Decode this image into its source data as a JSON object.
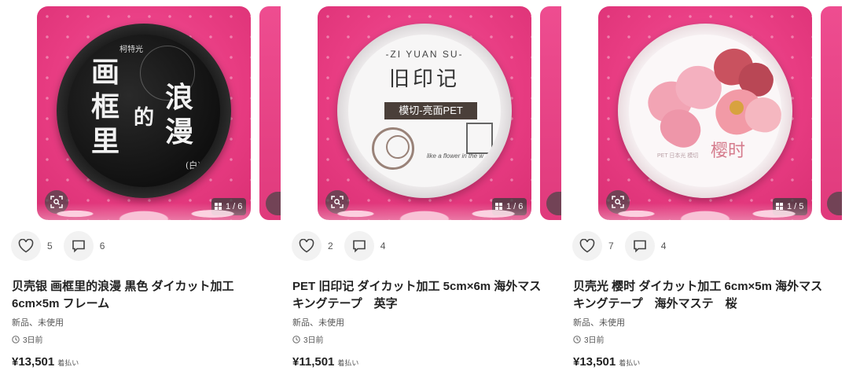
{
  "listings": [
    {
      "image": {
        "tape_lines": [
          "画框",
          "里",
          "的",
          "浪漫"
        ],
        "tape_small": "柯特光",
        "tape_tag": "(白)",
        "counter": "1 / 6"
      },
      "likes": "5",
      "comments": "6",
      "title": "贝壳银 画框里的浪漫 黒色 ダイカット加工 6cm×5m フレーム",
      "condition": "新品、未使用",
      "time": "3日前",
      "price": "¥13,501",
      "shipping": "着払い"
    },
    {
      "image": {
        "tape_brand": "-ZI YUAN SU-",
        "tape_title": "旧印记",
        "tape_band": "模切-亮面PET",
        "tape_script": "like a flower in the w",
        "counter": "1 / 6"
      },
      "likes": "2",
      "comments": "4",
      "title": "PET 旧印记 ダイカット加工 5cm×6m 海外マスキングテープ　英字",
      "condition": "新品、未使用",
      "time": "3日前",
      "price": "¥11,501",
      "shipping": "着払い"
    },
    {
      "image": {
        "tape_title": "樱时",
        "tape_sub": "PET 日本光 模切",
        "counter": "1 / 5"
      },
      "likes": "7",
      "comments": "4",
      "title": "贝壳光 樱时 ダイカット加工 6cm×5m 海外マスキングテープ　海外マステ　桜",
      "condition": "新品、未使用",
      "time": "3日前",
      "price": "¥13,501",
      "shipping": "着払い"
    }
  ],
  "colors": {
    "background": "#ffffff",
    "photo_pink": "#e83c82",
    "text": "#222222",
    "muted": "#555555"
  }
}
